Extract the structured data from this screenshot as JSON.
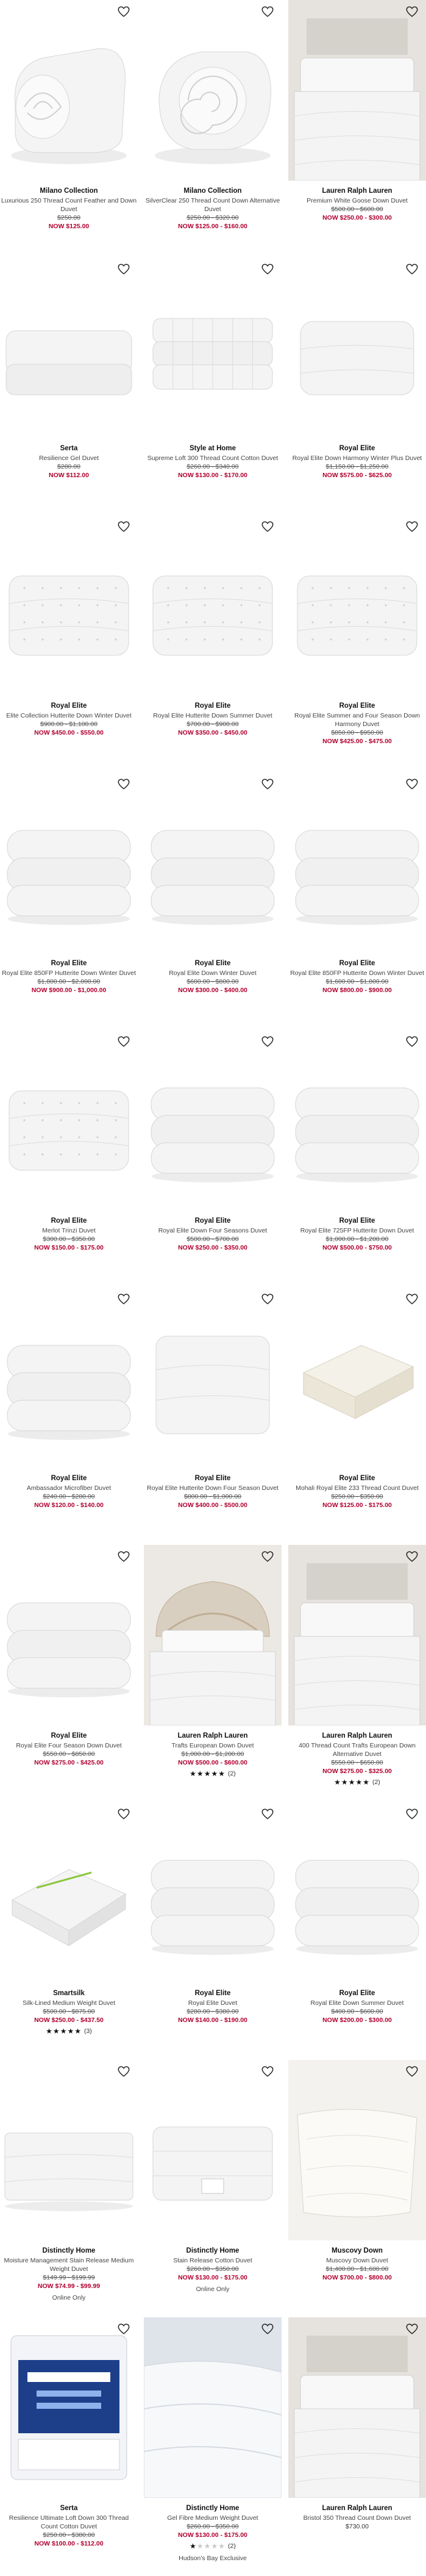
{
  "products": [
    {
      "brand": "Milano Collection",
      "name": "Luxurious 250 Thread Count Feather and Down Duvet",
      "original_price": "$250.00",
      "sale_price": "NOW $125.00",
      "image": "rolled-duvet",
      "wishlist_icon": "heart-outline-icon"
    },
    {
      "brand": "Milano Collection",
      "name": "SilverClear 250 Thread Count Down Alternative Duvet",
      "original_price": "$250.00 - $320.00",
      "sale_price": "NOW $125.00 - $160.00",
      "image": "rolled-duvet-spiral",
      "wishlist_icon": "heart-outline-icon"
    },
    {
      "brand": "Lauren Ralph Lauren",
      "name": "Premium White Goose Down Duvet",
      "original_price": "$500.00 - $600.00",
      "sale_price": "NOW $250.00 - $300.00",
      "image": "bedroom-duvet",
      "wishlist_icon": "heart-outline-icon"
    },
    {
      "brand": "Serta",
      "name": "Resilience Gel Duvet",
      "original_price": "$280.00",
      "sale_price": "NOW $112.00",
      "image": "folded-duvet-flat",
      "wishlist_icon": "heart-outline-icon"
    },
    {
      "brand": "Style at Home",
      "name": "Supreme Loft 300 Thread Count Cotton Duvet",
      "original_price": "$260.00 - $340.00",
      "sale_price": "NOW $130.00 - $170.00",
      "image": "folded-duvet-stack",
      "wishlist_icon": "heart-outline-icon"
    },
    {
      "brand": "Royal Elite",
      "name": "Royal Elite Down Harmony Winter Plus Duvet",
      "original_price": "$1,150.00 - $1,250.00",
      "sale_price": "NOW $575.00 - $625.00",
      "image": "folded-duvet-white",
      "wishlist_icon": "heart-outline-icon"
    },
    {
      "brand": "Royal Elite",
      "name": "Elite Collection Hutterite Down Winter Duvet",
      "original_price": "$900.00 - $1,100.00",
      "sale_price": "NOW $450.00 - $550.00",
      "image": "folded-duvet-quilted",
      "wishlist_icon": "heart-outline-icon"
    },
    {
      "brand": "Royal Elite",
      "name": "Royal Elite Hutterite Down Summer Duvet",
      "original_price": "$700.00 - $900.00",
      "sale_price": "NOW $350.00 - $450.00",
      "image": "folded-duvet-quilted",
      "wishlist_icon": "heart-outline-icon"
    },
    {
      "brand": "Royal Elite",
      "name": "Royal Elite Summer and Four Season Down Harmony Duvet",
      "original_price": "$850.00 - $950.00",
      "sale_price": "NOW $425.00 - $475.00",
      "image": "folded-duvet-quilted",
      "wishlist_icon": "heart-outline-icon"
    },
    {
      "brand": "Royal Elite",
      "name": "Royal Elite 850FP Hutterite Down Winter Duvet",
      "original_price": "$1,800.00 - $2,000.00",
      "sale_price": "NOW $900.00 - $1,000.00",
      "image": "folded-duvet-puffy",
      "wishlist_icon": "heart-outline-icon"
    },
    {
      "brand": "Royal Elite",
      "name": "Royal Elite Down Winter Duvet",
      "original_price": "$600.00 - $800.00",
      "sale_price": "NOW $300.00 - $400.00",
      "image": "folded-duvet-puffy",
      "wishlist_icon": "heart-outline-icon"
    },
    {
      "brand": "Royal Elite",
      "name": "Royal Elite 850FP Hutterite Down Winter Duvet",
      "original_price": "$1,600.00 - $1,800.00",
      "sale_price": "NOW $800.00 - $900.00",
      "image": "folded-duvet-puffy",
      "wishlist_icon": "heart-outline-icon"
    },
    {
      "brand": "Royal Elite",
      "name": "Merlot Trinzi Duvet",
      "original_price": "$300.00 - $350.00",
      "sale_price": "NOW $150.00 - $175.00",
      "image": "folded-duvet-quilted",
      "wishlist_icon": "heart-outline-icon"
    },
    {
      "brand": "Royal Elite",
      "name": "Royal Elite Down Four Seasons Duvet",
      "original_price": "$500.00 - $700.00",
      "sale_price": "NOW $250.00 - $350.00",
      "image": "folded-duvet-puffy",
      "wishlist_icon": "heart-outline-icon"
    },
    {
      "brand": "Royal Elite",
      "name": "Royal Elite 725FP Hutterite Down Duvet",
      "original_price": "$1,000.00 - $1,200.00",
      "sale_price": "NOW $500.00 - $750.00",
      "image": "folded-duvet-puffy",
      "wishlist_icon": "heart-outline-icon"
    },
    {
      "brand": "Royal Elite",
      "name": "Ambassador Microfiber Duvet",
      "original_price": "$240.00 - $280.00",
      "sale_price": "NOW $120.00 - $140.00",
      "image": "folded-duvet-puffy",
      "wishlist_icon": "heart-outline-icon"
    },
    {
      "brand": "Royal Elite",
      "name": "Royal Elite Hutterite Down Four Season Duvet",
      "original_price": "$800.00 - $1,000.00",
      "sale_price": "NOW $400.00 - $500.00",
      "image": "folded-duvet-square",
      "wishlist_icon": "heart-outline-icon"
    },
    {
      "brand": "Royal Elite",
      "name": "Mohali Royal Elite 233 Thread Count Duvet",
      "original_price": "$250.00 - $350.00",
      "sale_price": "NOW $125.00 - $175.00",
      "image": "folded-duvet-cream",
      "wishlist_icon": "heart-outline-icon"
    },
    {
      "brand": "Royal Elite",
      "name": "Royal Elite Four Season Down Duvet",
      "original_price": "$550.00 - $850.00",
      "sale_price": "NOW $275.00 - $425.00",
      "image": "folded-duvet-puffy",
      "wishlist_icon": "heart-outline-icon"
    },
    {
      "brand": "Lauren Ralph Lauren",
      "name": "Trafts European Down Duvet",
      "original_price": "$1,000.00 - $1,200.00",
      "sale_price": "NOW $500.00 - $600.00",
      "rating_stars": 5,
      "rating_count": "(2)",
      "image": "bedroom-ornate",
      "wishlist_icon": "heart-outline-icon"
    },
    {
      "brand": "Lauren Ralph Lauren",
      "name": "400 Thread Count Trafts European Down Alternative Duvet",
      "original_price": "$550.00 - $650.00",
      "sale_price": "NOW $275.00 - $325.00",
      "rating_stars": 5,
      "rating_count": "(2)",
      "image": "bedroom-duvet",
      "wishlist_icon": "heart-outline-icon"
    },
    {
      "brand": "Smartsilk",
      "name": "Silk-Lined Medium Weight Duvet",
      "original_price": "$500.00 - $875.00",
      "sale_price": "NOW $250.00 - $437.50",
      "rating_stars": 5,
      "rating_count": "(3)",
      "image": "folded-duvet-green-trim",
      "wishlist_icon": "heart-outline-icon"
    },
    {
      "brand": "Royal Elite",
      "name": "Royal Elite Duvet",
      "original_price": "$280.00 - $380.00",
      "sale_price": "NOW $140.00 - $190.00",
      "image": "folded-duvet-puffy",
      "wishlist_icon": "heart-outline-icon"
    },
    {
      "brand": "Royal Elite",
      "name": "Royal Elite Down Summer Duvet",
      "original_price": "$400.00 - $600.00",
      "sale_price": "NOW $200.00 - $300.00",
      "image": "folded-duvet-puffy",
      "wishlist_icon": "heart-outline-icon"
    },
    {
      "brand": "Distinctly Home",
      "name": "Moisture Management Stain Release Medium Weight Duvet",
      "original_price": "$149.99 - $199.99",
      "sale_price": "NOW $74.99 - $99.99",
      "note": "Online Only",
      "image": "flat-duvet-bed",
      "wishlist_icon": "heart-outline-icon"
    },
    {
      "brand": "Distinctly Home",
      "name": "Stain Release Cotton Duvet",
      "original_price": "$260.00 - $350.00",
      "sale_price": "NOW $130.00 - $175.00",
      "note": "Online Only",
      "image": "folded-duvet-tag",
      "wishlist_icon": "heart-outline-icon"
    },
    {
      "brand": "Muscovy Down",
      "name": "Muscovy Down Duvet",
      "original_price": "$1,400.00 - $1,600.00",
      "sale_price": "NOW $700.00 - $800.00",
      "image": "draped-duvet-bench",
      "wishlist_icon": "heart-outline-icon"
    },
    {
      "brand": "Serta",
      "name": "Resilience Ultimate Loft Down 300 Thread Count Cotton Duvet",
      "original_price": "$250.00 - $380.00",
      "sale_price": "NOW $100.00 - $112.00",
      "image": "packaged-duvet",
      "wishlist_icon": "heart-outline-icon"
    },
    {
      "brand": "Distinctly Home",
      "name": "Gel Fibre Medium Weight Duvet",
      "original_price": "$260.00 - $350.00",
      "sale_price": "NOW $130.00 - $175.00",
      "rating_stars": 1,
      "rating_count": "(2)",
      "note": "Hudson's Bay Exclusive",
      "image": "duvet-closeup-blue",
      "wishlist_icon": "heart-outline-icon"
    },
    {
      "brand": "Lauren Ralph Lauren",
      "name": "Bristol 350 Thread Count Down Duvet",
      "regular_price": "$730.00",
      "image": "bedroom-bright",
      "wishlist_icon": "heart-outline-icon"
    }
  ],
  "colors": {
    "sale": "#b1002f",
    "text": "#222222",
    "duvet": "#f4f4f4",
    "shadow": "#d6d6d6",
    "wall": "#e6e3de"
  }
}
